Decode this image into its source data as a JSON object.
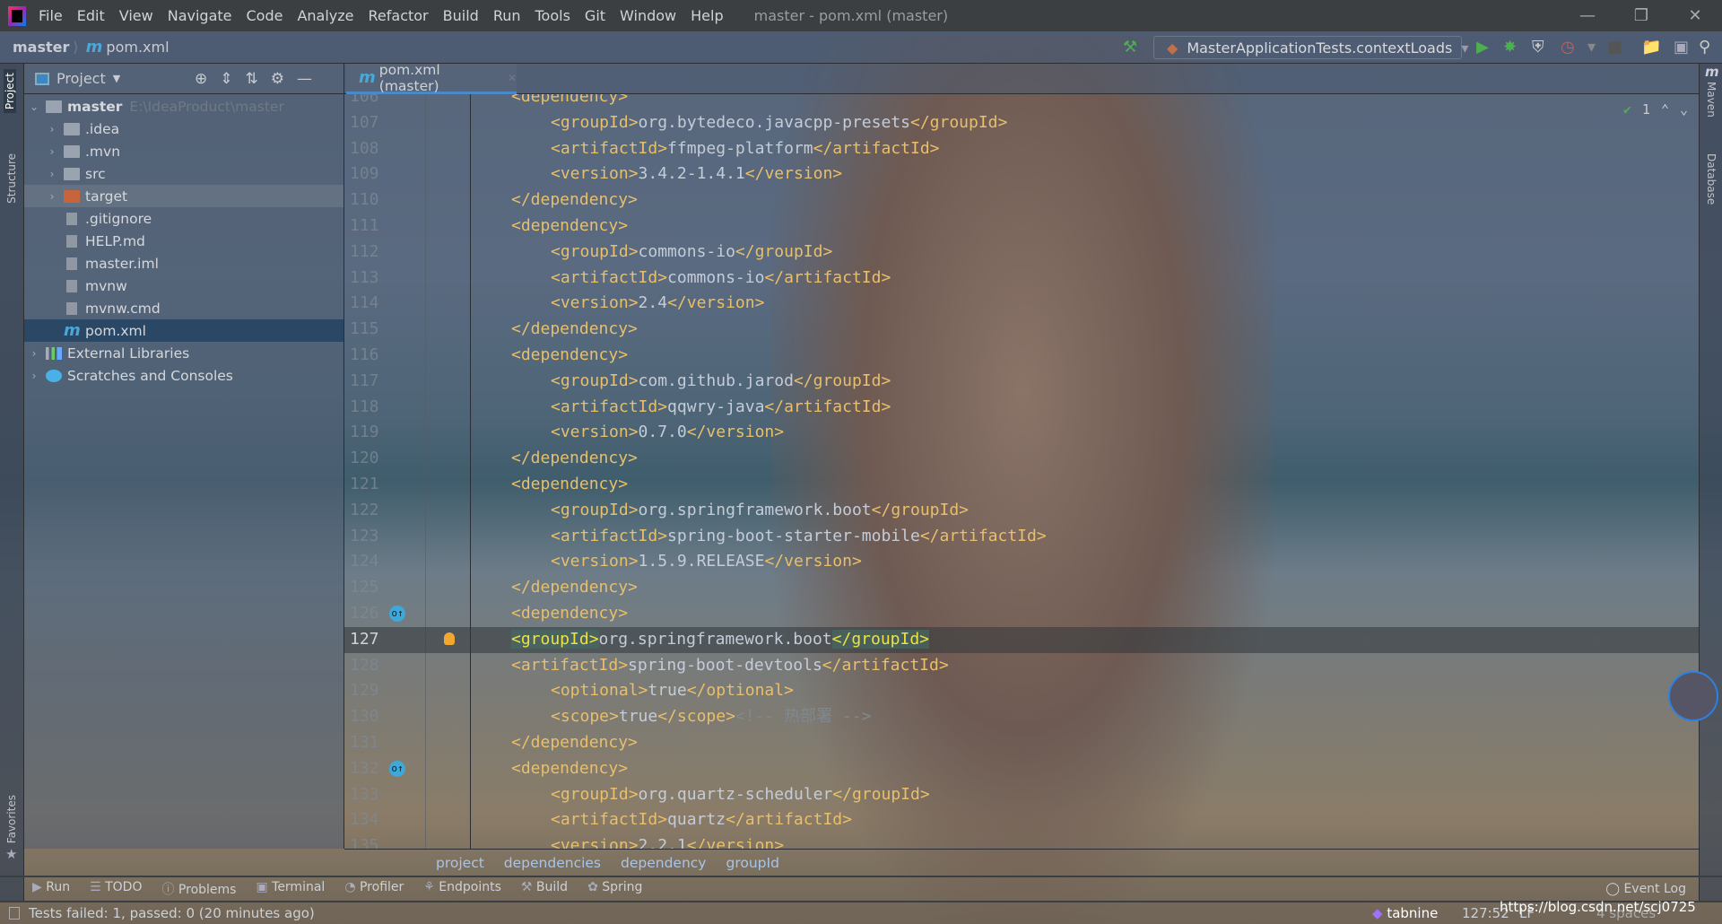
{
  "window": {
    "title": "master - pom.xml (master)",
    "menu": [
      "File",
      "Edit",
      "View",
      "Navigate",
      "Code",
      "Analyze",
      "Refactor",
      "Build",
      "Run",
      "Tools",
      "Git",
      "Window",
      "Help"
    ]
  },
  "nav": {
    "project": "master",
    "file": "pom.xml",
    "run_config": "MasterApplicationTests.contextLoads"
  },
  "side_tabs": {
    "project": "Project",
    "structure": "Structure",
    "favorites": "Favorites",
    "maven": "Maven",
    "database": "Database"
  },
  "project_panel": {
    "title": "Project",
    "root": {
      "name": "master",
      "path": "E:\\IdeaProduct\\master"
    },
    "items": [
      {
        "name": ".idea",
        "type": "folder"
      },
      {
        "name": ".mvn",
        "type": "folder"
      },
      {
        "name": "src",
        "type": "folder"
      },
      {
        "name": "target",
        "type": "folder-excluded"
      },
      {
        "name": ".gitignore",
        "type": "file"
      },
      {
        "name": "HELP.md",
        "type": "file"
      },
      {
        "name": "master.iml",
        "type": "file"
      },
      {
        "name": "mvnw",
        "type": "file"
      },
      {
        "name": "mvnw.cmd",
        "type": "file"
      },
      {
        "name": "pom.xml",
        "type": "maven",
        "selected": true
      }
    ],
    "extra": [
      "External Libraries",
      "Scratches and Consoles"
    ]
  },
  "editor": {
    "tab": "pom.xml (master)",
    "inspection_count": "1",
    "current_line": 127,
    "lines": [
      {
        "n": 106,
        "i": 1,
        "c": "<dependency>"
      },
      {
        "n": 107,
        "i": 2,
        "c": "<groupId>org.bytedeco.javacpp-presets</groupId>"
      },
      {
        "n": 108,
        "i": 2,
        "c": "<artifactId>ffmpeg-platform</artifactId>"
      },
      {
        "n": 109,
        "i": 2,
        "c": "<version>3.4.2-1.4.1</version>"
      },
      {
        "n": 110,
        "i": 1,
        "c": "</dependency>"
      },
      {
        "n": 111,
        "i": 1,
        "c": "<dependency>"
      },
      {
        "n": 112,
        "i": 2,
        "c": "<groupId>commons-io</groupId>"
      },
      {
        "n": 113,
        "i": 2,
        "c": "<artifactId>commons-io</artifactId>"
      },
      {
        "n": 114,
        "i": 2,
        "c": "<version>2.4</version>"
      },
      {
        "n": 115,
        "i": 1,
        "c": "</dependency>"
      },
      {
        "n": 116,
        "i": 1,
        "c": "<dependency>"
      },
      {
        "n": 117,
        "i": 2,
        "c": "<groupId>com.github.jarod</groupId>"
      },
      {
        "n": 118,
        "i": 2,
        "c": "<artifactId>qqwry-java</artifactId>"
      },
      {
        "n": 119,
        "i": 2,
        "c": "<version>0.7.0</version>"
      },
      {
        "n": 120,
        "i": 1,
        "c": "</dependency>"
      },
      {
        "n": 121,
        "i": 1,
        "c": "<dependency>"
      },
      {
        "n": 122,
        "i": 2,
        "c": "<groupId>org.springframework.boot</groupId>"
      },
      {
        "n": 123,
        "i": 2,
        "c": "<artifactId>spring-boot-starter-mobile</artifactId>"
      },
      {
        "n": 124,
        "i": 2,
        "c": "<version>1.5.9.RELEASE</version>"
      },
      {
        "n": 125,
        "i": 1,
        "c": "</dependency>"
      },
      {
        "n": 126,
        "i": 1,
        "c": "<dependency>"
      },
      {
        "n": 127,
        "i": 1,
        "c": "<groupId>org.springframework.boot</groupId>"
      },
      {
        "n": 128,
        "i": 1,
        "c": "<artifactId>spring-boot-devtools</artifactId>"
      },
      {
        "n": 129,
        "i": 2,
        "c": "<optional>true</optional>"
      },
      {
        "n": 130,
        "i": 2,
        "c": "<scope>true</scope><!-- 热部署 -->"
      },
      {
        "n": 131,
        "i": 1,
        "c": "</dependency>"
      },
      {
        "n": 132,
        "i": 1,
        "c": "<dependency>"
      },
      {
        "n": 133,
        "i": 2,
        "c": "<groupId>org.quartz-scheduler</groupId>"
      },
      {
        "n": 134,
        "i": 2,
        "c": "<artifactId>quartz</artifactId>"
      },
      {
        "n": 135,
        "i": 2,
        "c": "<version>2.2.1</version>"
      }
    ]
  },
  "breadcrumbs": [
    "project",
    "dependencies",
    "dependency",
    "groupId"
  ],
  "tool_windows": [
    "Run",
    "TODO",
    "Problems",
    "Terminal",
    "Profiler",
    "Endpoints",
    "Build",
    "Spring"
  ],
  "event_log": "Event Log",
  "status": {
    "message": "Tests failed: 1, passed: 0 (20 minutes ago)",
    "plugin": "tabnine",
    "position": "127:52",
    "line_sep": "LF",
    "indent": "4 spaces",
    "watermark": "https://blog.csdn.net/scj0725"
  },
  "colors": {
    "tag": "#e8bf6a",
    "text": "#c4ccd8",
    "selection": "#2a4866",
    "accent": "#4a88c7"
  }
}
